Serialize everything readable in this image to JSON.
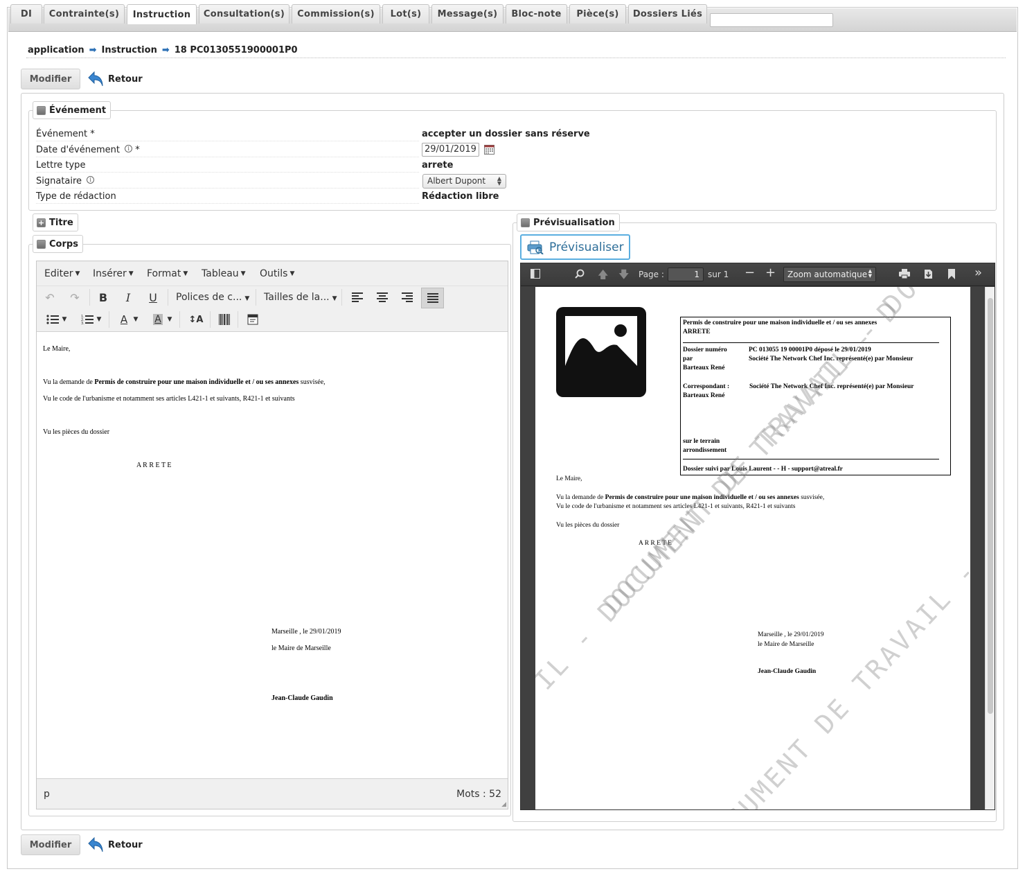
{
  "tabs": [
    "DI",
    "Contrainte(s)",
    "Instruction",
    "Consultation(s)",
    "Commission(s)",
    "Lot(s)",
    "Message(s)",
    "Bloc-note",
    "Pièce(s)",
    "Dossiers Liés"
  ],
  "active_tab": "Instruction",
  "breadcrumb": [
    "application",
    "Instruction",
    "18 PC0130551900001P0"
  ],
  "actions": {
    "modify": "Modifier",
    "back": "Retour"
  },
  "evenement_section": {
    "legend": "Événement",
    "fields": {
      "evenement": {
        "label": "Événement *",
        "value": "accepter un dossier sans réserve"
      },
      "date": {
        "label": "Date d'événement",
        "required": "*",
        "value": "29/01/2019"
      },
      "lettre_type": {
        "label": "Lettre type",
        "value": "arrete"
      },
      "signataire": {
        "label": "Signataire",
        "value": "Albert Dupont"
      },
      "type_redaction": {
        "label": "Type de rédaction",
        "value": "Rédaction libre"
      }
    }
  },
  "titre_legend": "Titre",
  "corps_legend": "Corps",
  "preview_legend": "Prévisualisation",
  "editor": {
    "menus": [
      "Editer",
      "Insérer",
      "Format",
      "Tableau",
      "Outils"
    ],
    "font_family_placeholder": "Polices de c...",
    "font_size_placeholder": "Tailles de la...",
    "content": {
      "greeting": "Le Maire,",
      "vu1_prefix": "Vu la demande de ",
      "vu1_bold": "Permis de construire pour une maison individuelle et / ou ses annexes",
      "vu1_suffix": " susvisée,",
      "vu2": "Vu le code de l'urbanisme et notamment ses articles L421-1 et suivants, R421-1 et suivants",
      "vu3": "Vu les pièces du dossier",
      "arrete": "A R R E T E",
      "place_date": "Marseille , le  29/01/2019",
      "signer_title": "le Maire de Marseille",
      "signer_name": "Jean-Claude Gaudin"
    },
    "status_path": "p",
    "word_count": "Mots : 52"
  },
  "preview": {
    "button_label": "Prévisualiser",
    "toolbar": {
      "page_label": "Page :",
      "page_value": "1",
      "of_label": "sur 1",
      "zoom": "Zoom automatique"
    },
    "header_box": {
      "title": "Permis de construire pour une maison individuelle et / ou ses annexes",
      "subtitle": "ARRETE",
      "dossier_label": "Dossier numéro",
      "dossier_value": "PC 013055 19 00001P0  déposé le 29/01/2019",
      "par_label": "par",
      "par_value": "Société The Network Chef Inc. représenté(e) par Monsieur",
      "par_value2": "Barteaux René",
      "correspondant_label": "Correspondant :",
      "correspondant_value": "Société The Network Chef Inc. représenté(e) par Monsieur",
      "correspondant_value2": "Barteaux René",
      "terrain": "sur le terrain",
      "arrondissement": "arrondissement",
      "suivi": "Dossier suivi par  Louis Laurent -  - H - support@atreal.fr"
    },
    "body": {
      "greeting": "Le Maire,",
      "vu1_prefix": "Vu la demande de ",
      "vu1_bold": "Permis de construire pour une maison individuelle et / ou ses annexes",
      "vu1_suffix": " susvisée,",
      "vu2": "Vu le code de l'urbanisme et notamment ses articles L421-1 et suivants, R421-1 et suivants",
      "vu3": "Vu les pièces du dossier",
      "arrete": "A R R E T E",
      "place_date": "Marseille , le  29/01/2019",
      "signer_title": "le Maire de Marseille",
      "signer_name": "Jean-Claude Gaudin"
    },
    "watermark": "DOCUMENT DE TRAVAIL - DOCUMENT DE TRAVAIL - DOC",
    "watermark2": "IL - DOCUMENT DE TRAVAIL - D",
    "watermark3": "DOCUMENT DE TRAVAIL -"
  }
}
